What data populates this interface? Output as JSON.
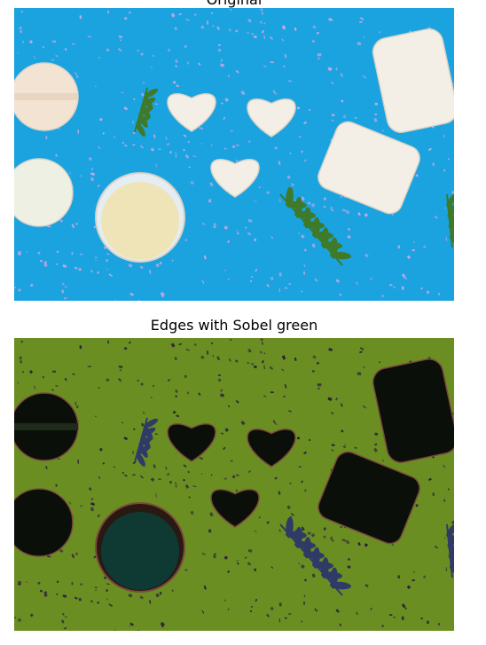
{
  "panels": [
    {
      "title": "Original",
      "background": "#1aa3df",
      "sprinkle_color": "#c9a8e6",
      "leaf_color": "#3f7a2a",
      "soap_color": "#f4efe6",
      "jar_liquid": "#eee4b8"
    },
    {
      "title": "Edges with Sobel green",
      "background": "#6b8e23",
      "sprinkle_color": "#2a1e3a",
      "leaf_color": "#2f3b66",
      "soap_color": "#0b0f0a",
      "jar_liquid": "#0f3a34"
    }
  ]
}
